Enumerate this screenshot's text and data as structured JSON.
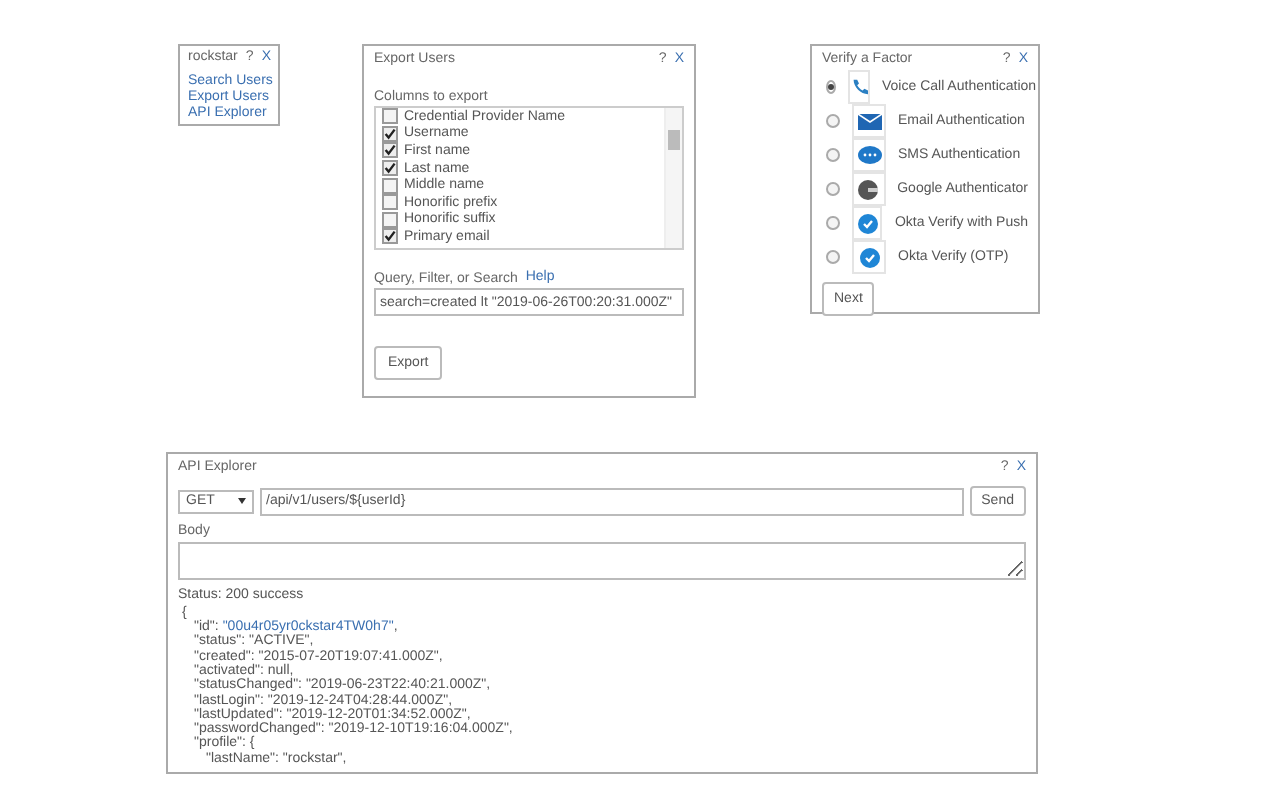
{
  "user_menu": {
    "title": "rockstar",
    "help": "?",
    "close": "X",
    "links": [
      "Search Users",
      "Export Users",
      "API Explorer"
    ]
  },
  "export_users": {
    "title": "Export Users",
    "help": "?",
    "close": "X",
    "columns_label": "Columns to export",
    "columns": [
      {
        "label": "Credential Provider Name",
        "checked": false
      },
      {
        "label": "Username",
        "checked": true
      },
      {
        "label": "First name",
        "checked": true
      },
      {
        "label": "Last name",
        "checked": true
      },
      {
        "label": "Middle name",
        "checked": false
      },
      {
        "label": "Honorific prefix",
        "checked": false
      },
      {
        "label": "Honorific suffix",
        "checked": false
      },
      {
        "label": "Primary email",
        "checked": true
      }
    ],
    "query_label": "Query, Filter, or Search",
    "help_link": "Help",
    "query_value": "search=created lt \"2019-06-26T00:20:31.000Z\"",
    "button": "Export"
  },
  "verify_factor": {
    "title": "Verify a Factor",
    "help": "?",
    "close": "X",
    "factors": [
      {
        "label": "Voice Call Authentication",
        "kind": "phone",
        "selected": true
      },
      {
        "label": "Email Authentication",
        "kind": "email",
        "selected": false
      },
      {
        "label": "SMS Authentication",
        "kind": "sms",
        "selected": false
      },
      {
        "label": "Google Authenticator",
        "kind": "google",
        "selected": false
      },
      {
        "label": "Okta Verify with Push",
        "kind": "okta",
        "selected": false
      },
      {
        "label": "Okta Verify (OTP)",
        "kind": "okta",
        "selected": false
      }
    ],
    "button": "Next"
  },
  "api_explorer": {
    "title": "API Explorer",
    "help": "?",
    "close": "X",
    "method": "GET",
    "url": "/api/v1/users/${userId}",
    "send": "Send",
    "body_label": "Body",
    "status": "Status: 200 success",
    "response": [
      {
        "text": "{"
      },
      {
        "text": "\"id\": ",
        "link": "\"00u4r05yr0ckstar4TW0h7\"",
        "after": ","
      },
      {
        "text": "\"status\": \"ACTIVE\","
      },
      {
        "text": "\"created\": \"2015-07-20T19:07:41.000Z\","
      },
      {
        "text": "\"activated\": null,"
      },
      {
        "text": "\"statusChanged\": \"2019-06-23T22:40:21.000Z\","
      },
      {
        "text": "\"lastLogin\": \"2019-12-24T04:28:44.000Z\","
      },
      {
        "text": "\"lastUpdated\": \"2019-12-20T01:34:52.000Z\","
      },
      {
        "text": "\"passwordChanged\": \"2019-12-10T19:16:04.000Z\","
      },
      {
        "text": "\"profile\": {",
        "children": [
          {
            "text": "\"lastName\": \"rockstar\","
          }
        ]
      }
    ]
  }
}
